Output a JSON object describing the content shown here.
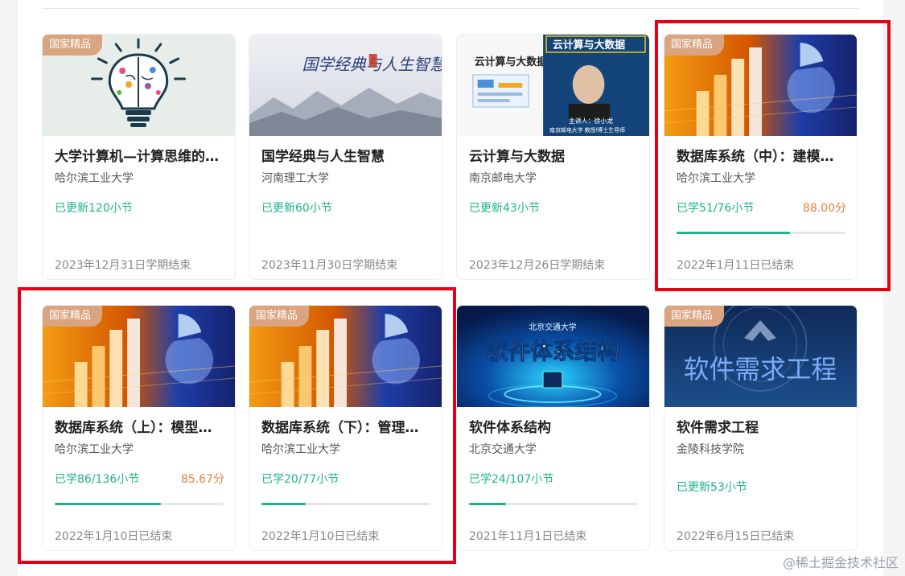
{
  "badge_label": "国家精品",
  "watermark": "@稀土掘金技术社区",
  "colors": {
    "green": "#1cb58a",
    "orange": "#f07c3c",
    "badge": "#d9a47f",
    "highlight": "#e60012"
  },
  "courses": [
    {
      "title": "大学计算机—计算思维的视角",
      "school": "哈尔滨工业大学",
      "status": "已更新120小节",
      "end": "2023年12月31日学期结束",
      "badge": true,
      "image": "brain-lightbulb"
    },
    {
      "title": "国学经典与人生智慧",
      "school": "河南理工大学",
      "status": "已更新60小节",
      "end": "2023年11月30日学期结束",
      "badge": false,
      "image": "ink-landscape",
      "image_text": "国学经典与人生智慧"
    },
    {
      "title": "云计算与大数据",
      "school": "南京邮电大学",
      "status": "已更新43小节",
      "end": "2023年12月26日学期结束",
      "badge": false,
      "image": "cloud-lecture",
      "image_text": "云计算与大数据",
      "image_book": "云计算与大数据",
      "image_caption": "主讲人：徐小龙",
      "image_caption2": "南京邮电大学 教授/博士生导师"
    },
    {
      "title": "数据库系统（中）：建模与设计",
      "school": "哈尔滨工业大学",
      "status": "已学51/76小节",
      "score": "88.00分",
      "progress": 0.67,
      "end": "2022年1月11日已结束",
      "badge": true,
      "image": "database-chart"
    },
    {
      "title": "数据库系统（上）：模型与语言",
      "school": "哈尔滨工业大学",
      "status": "已学86/136小节",
      "score": "85.67分",
      "progress": 0.63,
      "end": "2022年1月10日已结束",
      "badge": true,
      "image": "database-chart"
    },
    {
      "title": "数据库系统（下）：管理与技术",
      "school": "哈尔滨工业大学",
      "status": "已学20/77小节",
      "progress": 0.26,
      "end": "2022年1月10日已结束",
      "badge": true,
      "image": "database-chart"
    },
    {
      "title": "软件体系结构",
      "school": "北京交通大学",
      "status": "已学24/107小节",
      "progress": 0.22,
      "end": "2021年11月1日已结束",
      "badge": false,
      "image": "software-architecture",
      "image_text": "软件体系结构",
      "image_subtext": "北京交通大学"
    },
    {
      "title": "软件需求工程",
      "school": "金陵科技学院",
      "status": "已更新53小节",
      "end": "2022年6月15日已结束",
      "badge": true,
      "image": "requirements-seal",
      "image_text": "软件需求工程"
    }
  ]
}
